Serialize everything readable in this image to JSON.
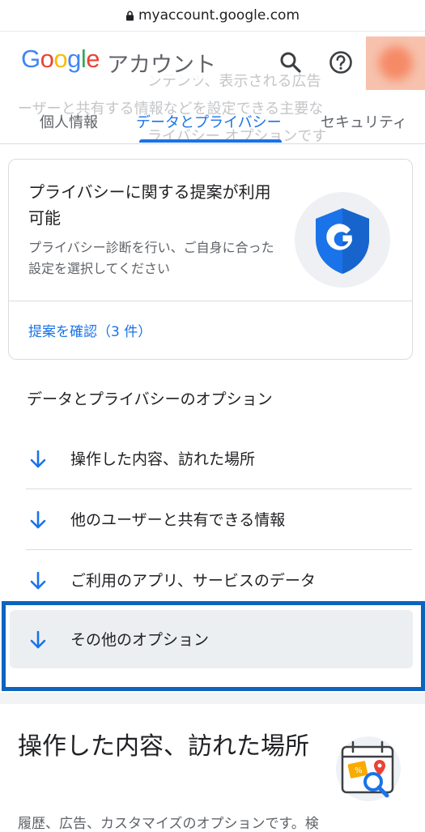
{
  "browser": {
    "url": "myaccount.google.com"
  },
  "header": {
    "logo_text": "Google",
    "title": "アカウント",
    "ghost_lines": [
      "ンテンツ、表示される広告",
      "ーザーと共有する情報などを設定できる主要な",
      "ライバシー オプションです"
    ],
    "icons": [
      "search-icon",
      "help-icon"
    ]
  },
  "tabs": [
    {
      "label": "個人情報",
      "active": false
    },
    {
      "label": "データとプライバシー",
      "active": true
    },
    {
      "label": "セキュリティ",
      "active": false
    }
  ],
  "suggestion_card": {
    "title": "プライバシーに関する提案が利用可能",
    "description": "プライバシー診断を行い、ご自身に合った設定を選択してください",
    "link": "提案を確認（3 件）",
    "icon": "google-shield-icon"
  },
  "options_section": {
    "title": "データとプライバシーのオプション",
    "items": [
      {
        "label": "操作した内容、訪れた場所",
        "icon": "arrow-down-icon"
      },
      {
        "label": "他のユーザーと共有できる情報",
        "icon": "arrow-down-icon"
      },
      {
        "label": "ご利用のアプリ、サービスのデータ",
        "icon": "arrow-down-icon"
      },
      {
        "label": "その他のオプション",
        "icon": "arrow-down-icon",
        "highlighted": true
      }
    ]
  },
  "activity_section": {
    "title": "操作した内容、訪れた場所",
    "description": "履歴、広告、カスタマイズのオプションです。検",
    "icon": "calendar-map-search-icon"
  },
  "colors": {
    "accent": "#1a73e8",
    "highlight_frame": "#0b64be",
    "shield_blue": "#1a73e8"
  }
}
